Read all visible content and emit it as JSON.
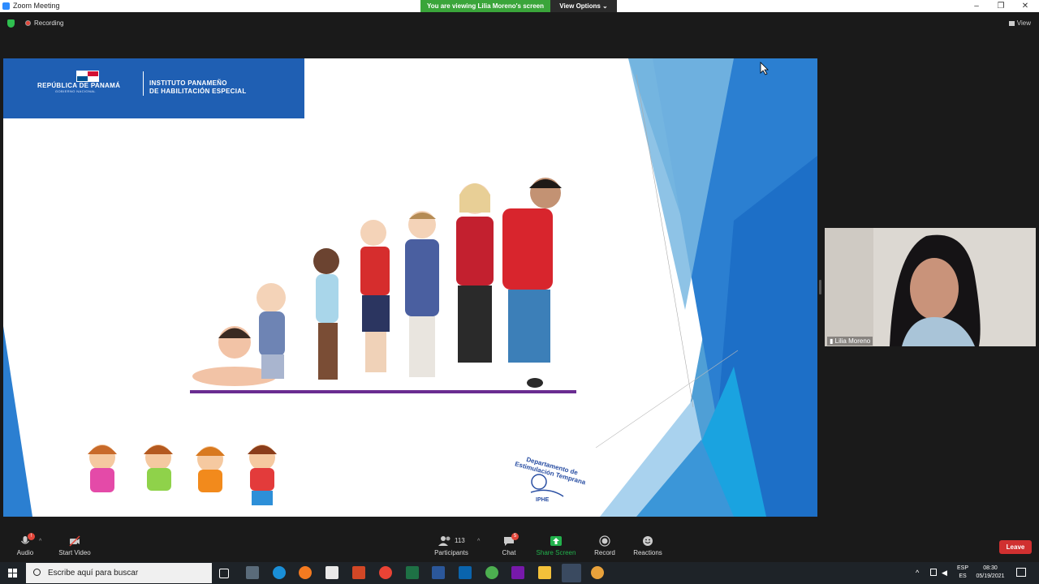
{
  "window": {
    "title": "Zoom Meeting",
    "viewing_banner": "You are viewing Lilia Moreno's screen",
    "view_options_label": "View Options",
    "view_options_caret": "⌄",
    "minimize_glyph": "–",
    "restore_glyph": "❐",
    "close_glyph": "✕"
  },
  "meeting_bar": {
    "recording_label": "Recording",
    "view_label": "View"
  },
  "slide": {
    "header": {
      "country": "REPÚBLICA DE PANAMÁ",
      "government": "GOBIERNO NACIONAL",
      "institute_line1": "INSTITUTO PANAMEÑO",
      "institute_line2": "DE HABILITACIÓN ESPECIAL"
    },
    "department_logo": "Departamento de Estimulación Temprana",
    "department_acronym": "IPHE"
  },
  "participant": {
    "name": "Lilia Moreno"
  },
  "toolbar": {
    "audio_label": "Audio",
    "audio_badge": "!",
    "start_video_label": "Start Video",
    "participants_label": "Participants",
    "participants_count": "113",
    "chat_label": "Chat",
    "chat_badge": "5",
    "share_screen_label": "Share Screen",
    "record_label": "Record",
    "reactions_label": "Reactions",
    "leave_label": "Leave",
    "caret": "^"
  },
  "taskbar": {
    "search_placeholder": "Escribe aquí para buscar",
    "lang_top": "ESP",
    "lang_bottom": "ES",
    "time": "08:30",
    "date": "05/19/2021"
  },
  "colors": {
    "zoom_blue": "#2d8cff",
    "banner_green": "#3aa53a",
    "share_green": "#22b14c",
    "leave_red": "#d03030",
    "slide_blue": "#1f5fb3"
  }
}
